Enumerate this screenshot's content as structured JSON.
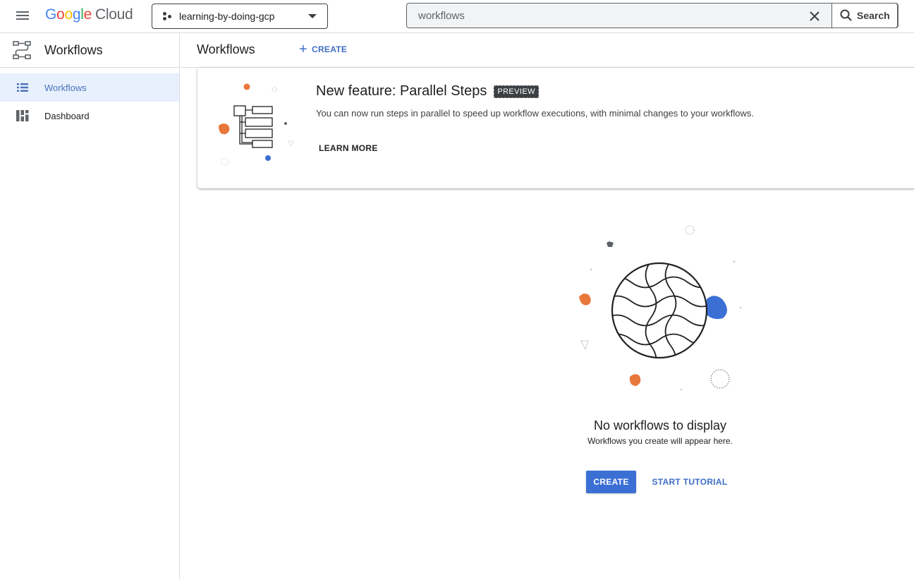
{
  "header": {
    "logo_google": [
      "G",
      "o",
      "o",
      "g",
      "l",
      "e"
    ],
    "logo_cloud": "Cloud",
    "project_name": "learning-by-doing-gcp",
    "search_value": "workflows",
    "search_button_label": "Search",
    "icons": {
      "menu": "hamburger-menu-icon",
      "project": "project-hierarchy-icon",
      "clear": "close-icon",
      "search": "search-icon"
    }
  },
  "sidebar": {
    "product_title": "Workflows",
    "items": [
      {
        "label": "Workflows",
        "icon": "list-icon",
        "active": true
      },
      {
        "label": "Dashboard",
        "icon": "dashboard-icon",
        "active": false
      }
    ]
  },
  "main": {
    "title": "Workflows",
    "create_label": "CREATE"
  },
  "feature_card": {
    "title": "New feature: Parallel Steps",
    "badge": "PREVIEW",
    "description": "You can now run steps in parallel to speed up workflow executions, with minimal changes to your workflows.",
    "learn_more": "LEARN MORE"
  },
  "empty_state": {
    "title": "No workflows to display",
    "subtitle": "Workflows you create will appear here.",
    "create_button": "CREATE",
    "tutorial_button": "START TUTORIAL"
  },
  "colors": {
    "accent_blue": "#3b6fd4",
    "link_blue": "#3e6ec6",
    "active_nav_bg": "#e8f0fe",
    "orange": "#e8773a",
    "border": "#dadce0"
  }
}
